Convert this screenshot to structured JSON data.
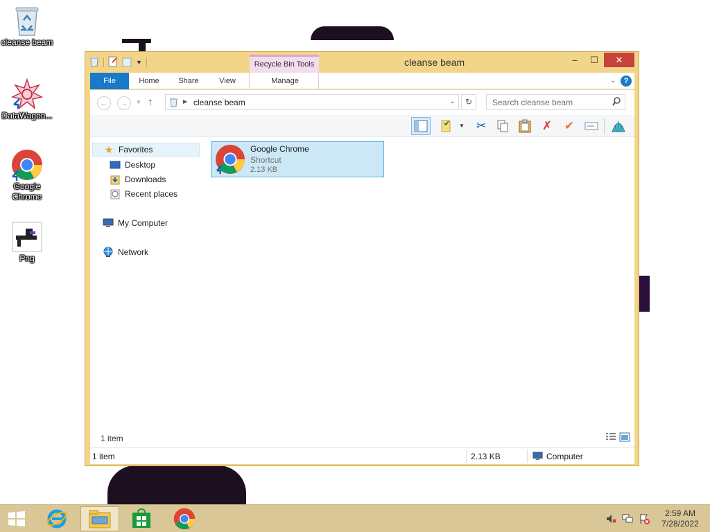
{
  "desktop": {
    "icons": [
      {
        "label": "cleanse beam",
        "icon": "recycle-bin-icon"
      },
      {
        "label": "DataWagon...",
        "icon": "datawagon-icon"
      },
      {
        "label": "Google Chrome",
        "icon": "chrome-icon"
      },
      {
        "label": "Png",
        "icon": "png-image-icon"
      }
    ]
  },
  "window": {
    "title": "cleanse beam",
    "context_tab": "Recycle Bin Tools",
    "controls": {
      "minimize": "–",
      "maximize": "☐",
      "close": "✕"
    },
    "ribbon": {
      "tabs": [
        "File",
        "Home",
        "Share",
        "View",
        "Manage"
      ],
      "help": "?"
    },
    "address": {
      "path": "cleanse beam",
      "search_placeholder": "Search cleanse beam"
    },
    "nav": {
      "favorites": "Favorites",
      "desktop": "Desktop",
      "downloads": "Downloads",
      "recent": "Recent places",
      "computer": "My Computer",
      "network": "Network"
    },
    "file": {
      "name": "Google Chrome",
      "type": "Shortcut",
      "size": "2.13 KB"
    },
    "content_count": "1 item",
    "status": {
      "items": "1 item",
      "size": "2.13 KB",
      "location": "Computer"
    }
  },
  "taskbar": {
    "time": "2:59 AM",
    "date": "7/28/2022"
  },
  "colors": {
    "window_frame": "#f3d58a",
    "accent_blue": "#1979ca",
    "selection": "#cce8f6",
    "taskbar": "#d9c798",
    "close_red": "#c7423b"
  }
}
